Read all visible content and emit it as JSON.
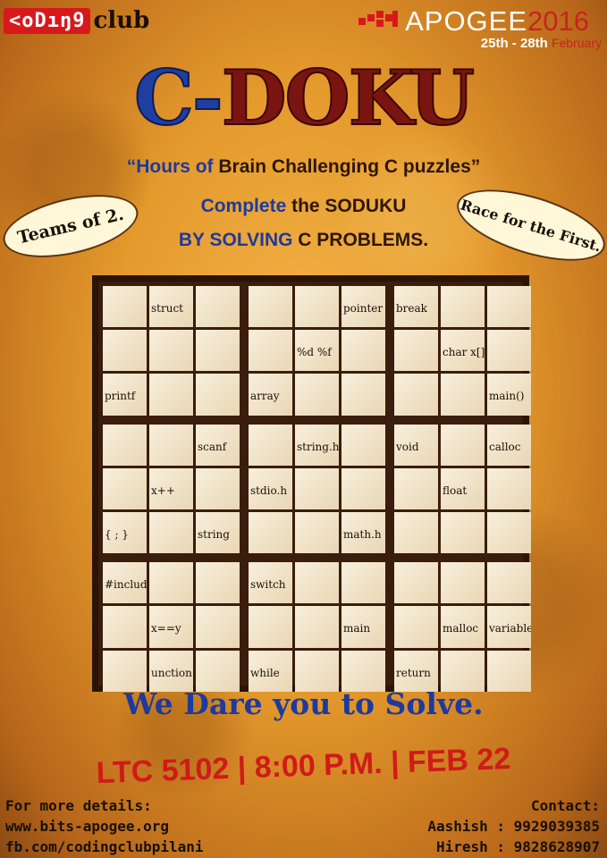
{
  "header": {
    "club_logo_text": "<oDıŋ9",
    "club_word": "club",
    "event_name": "APOGEE",
    "event_year": "2016",
    "event_dates": "25th - 28th",
    "event_month": "February"
  },
  "title": {
    "c": "C-",
    "doku": "DOKU"
  },
  "tagline": {
    "part1": "“Hours of",
    "part2": "Brain Challenging C puzzles”"
  },
  "line2": {
    "part1": "Complete",
    "part2": "the SODUKU"
  },
  "line3": {
    "part1": "BY SOLVING",
    "part2": "C PROBLEMS."
  },
  "bubbles": {
    "left": "Teams of 2.",
    "right": "Race for the First."
  },
  "grid": [
    [
      "",
      "struct",
      "",
      "",
      "",
      "pointer",
      "break",
      "",
      ""
    ],
    [
      "",
      "",
      "",
      "",
      "%d %f",
      "",
      "",
      "char x[]",
      ""
    ],
    [
      "printf",
      "",
      "",
      "array",
      "",
      "",
      "",
      "",
      "main()"
    ],
    [
      "",
      "",
      "scanf",
      "",
      "string.h",
      "",
      "void",
      "",
      "calloc"
    ],
    [
      "",
      "x++",
      "",
      "stdio.h",
      "",
      "",
      "",
      "float",
      ""
    ],
    [
      "{ ; }",
      "",
      "string",
      "",
      "",
      "math.h",
      "",
      "",
      ""
    ],
    [
      "#include",
      "",
      "",
      "switch",
      "",
      "",
      "",
      "",
      ""
    ],
    [
      "",
      "x==y",
      "",
      "",
      "",
      "main",
      "",
      "malloc",
      "variable"
    ],
    [
      "",
      "unction",
      "",
      "while",
      "",
      "",
      "return",
      "",
      ""
    ]
  ],
  "dare_text": "We Dare you to Solve.",
  "event_info": "LTC 5102 | 8:00 P.M. | FEB 22",
  "footer": {
    "details_label": "For more details:",
    "website": "www.bits-apogee.org",
    "facebook": "fb.com/codingclubpilani",
    "contact_label": "Contact:",
    "contact1": "Aashish : 9929039385",
    "contact2": "Hiresh : 9828628907"
  }
}
